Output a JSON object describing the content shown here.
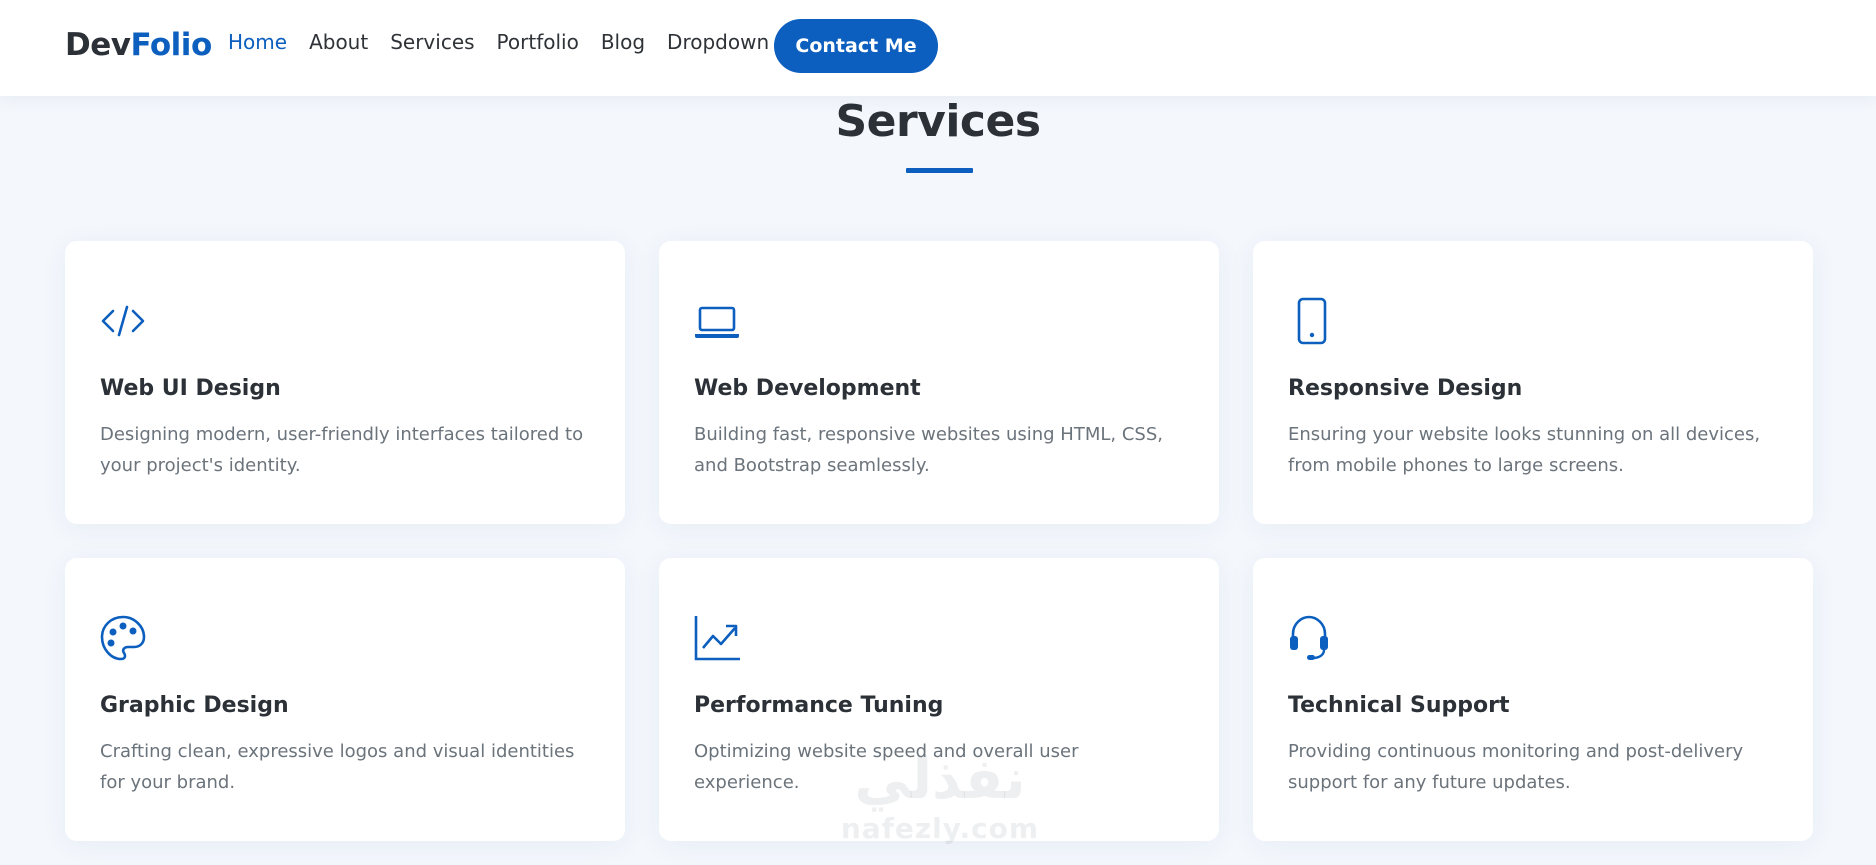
{
  "header": {
    "logo_part1": "Dev",
    "logo_part2": "Folio",
    "nav": [
      {
        "label": "Home",
        "active": true
      },
      {
        "label": "About"
      },
      {
        "label": "Services"
      },
      {
        "label": "Portfolio"
      },
      {
        "label": "Blog"
      },
      {
        "label": "Dropdown",
        "icon": "chevron-down-icon"
      }
    ],
    "contact_label": "Contact Me"
  },
  "section": {
    "title": "Services"
  },
  "cards": [
    {
      "icon": "code-icon",
      "title": "Web UI Design",
      "desc": "Designing modern, user-friendly interfaces tailored to your project's identity."
    },
    {
      "icon": "laptop-icon",
      "title": "Web Development",
      "desc": "Building fast, responsive websites using HTML, CSS, and Bootstrap seamlessly."
    },
    {
      "icon": "phone-icon",
      "title": "Responsive Design",
      "desc": "Ensuring your website looks stunning on all devices, from mobile phones to large screens."
    },
    {
      "icon": "palette-icon",
      "title": "Graphic Design",
      "desc": "Crafting clean, expressive logos and visual identities for your brand."
    },
    {
      "icon": "graph-up-icon",
      "title": "Performance Tuning",
      "desc": "Optimizing website speed and overall user experience."
    },
    {
      "icon": "headset-icon",
      "title": "Technical Support",
      "desc": "Providing continuous monitoring and post-delivery support for any future updates."
    }
  ],
  "watermark": {
    "arabic": "نفذلي",
    "latin": "nafezly.com"
  },
  "colors": {
    "accent": "#0c5fbe",
    "heading": "#2b3137",
    "body_text": "#6b737b",
    "background": "#f4f8fd"
  }
}
